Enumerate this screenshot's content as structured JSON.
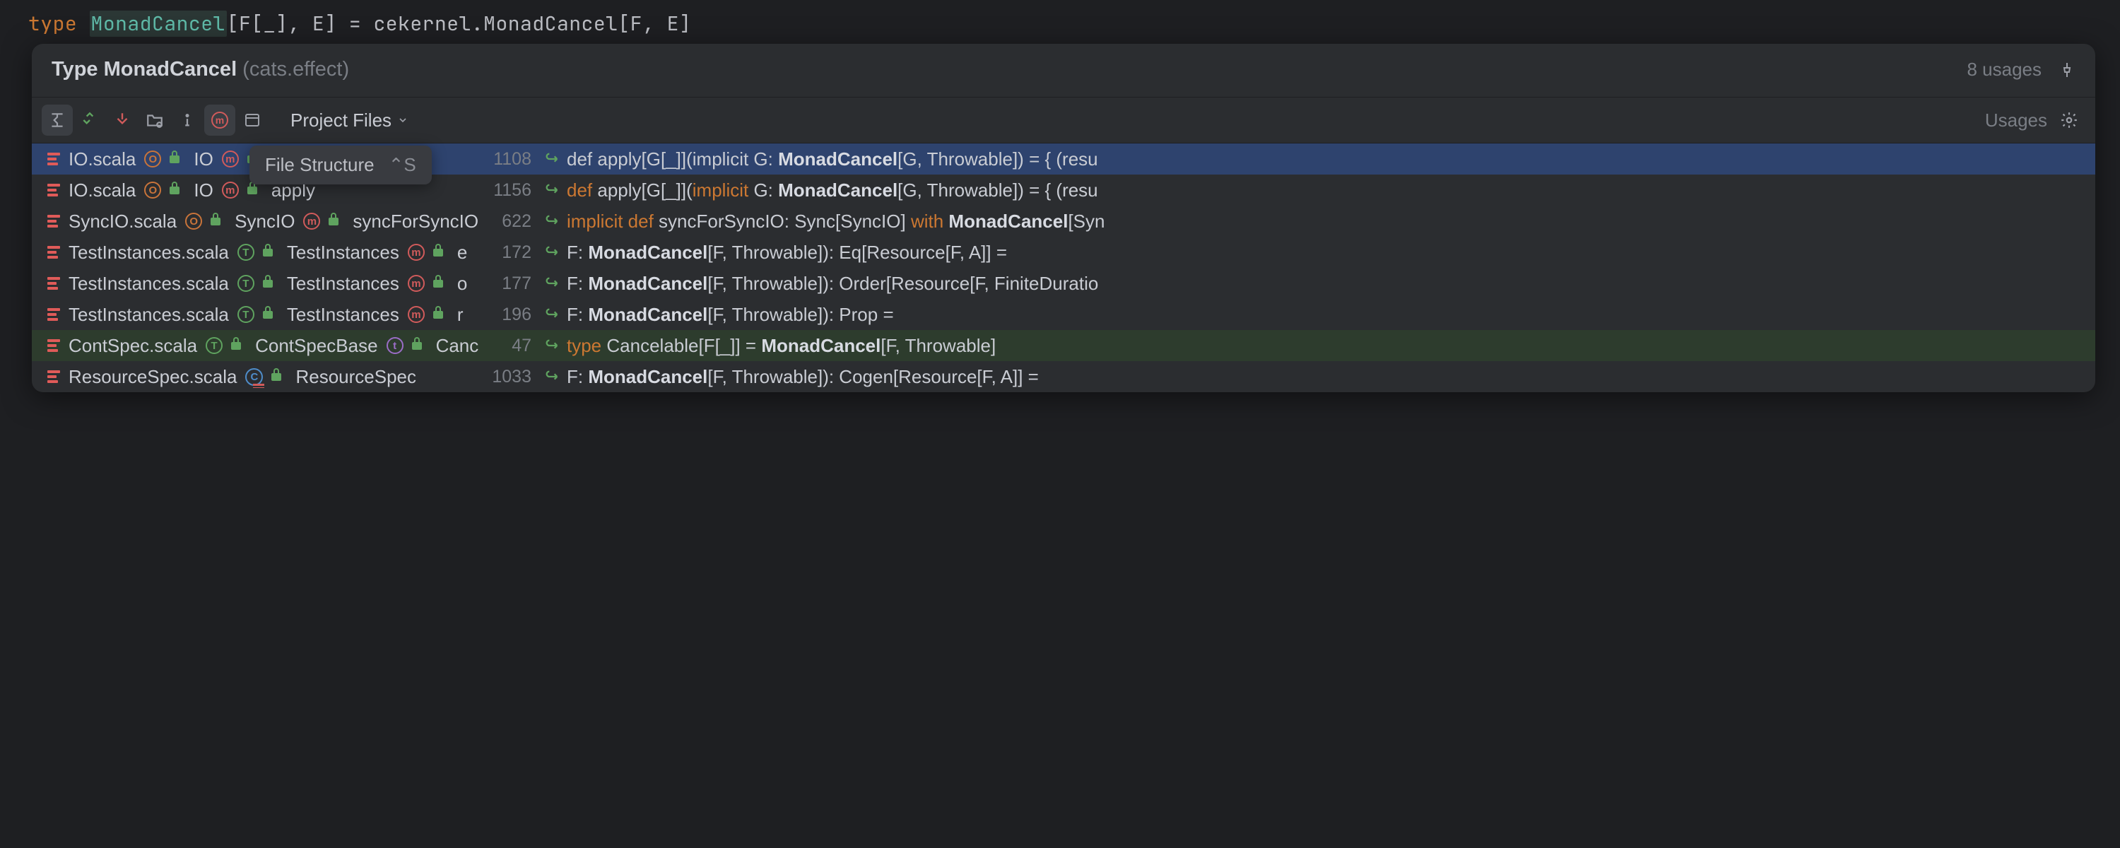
{
  "editor_code": {
    "keyword": "type",
    "name": "MonadCancel",
    "params": "[F[_], E]",
    "eq": " = ",
    "rhs_qual": "cekernel.MonadCancel",
    "rhs_params": "[F, E]"
  },
  "popup": {
    "title_prefix": "Type ",
    "title_name": "MonadCancel",
    "title_pkg": " (cats.effect)",
    "usage_count": "8 usages",
    "scope": "Project Files",
    "usages_label": "Usages"
  },
  "tooltip": {
    "label": "File Structure",
    "shortcut": "⌃S"
  },
  "rows": [
    {
      "file": "IO.scala",
      "class_kind": "O",
      "class_name": "IO",
      "member_kind": "m",
      "member_name": "apply",
      "truncated": true,
      "line": "1108",
      "code_pre": "def apply[G[_]](implicit G: ",
      "code_match": "MonadCancel",
      "code_post": "[G, Throwable]) = { (resu",
      "selected": true
    },
    {
      "file": "IO.scala",
      "class_kind": "O",
      "class_name": "IO",
      "member_kind": "m",
      "member_name": "apply",
      "line": "1156",
      "code_html": "<span class='hl-kw'>def</span> apply[G[_]](<span class='hl-kw'>implicit</span> G: <span class='bold'>MonadCancel</span>[G, Throwable]) = { (resu"
    },
    {
      "file": "SyncIO.scala",
      "class_kind": "O",
      "class_name": "SyncIO",
      "member_kind": "m",
      "member_name": "syncForSyncIO",
      "line": "622",
      "code_html": "<span class='hl-kw'>implicit def</span> syncForSyncIO: Sync[SyncIO] <span class='hl-kw'>with</span> <span class='bold'>MonadCancel</span>[Syn"
    },
    {
      "file": "TestInstances.scala",
      "class_kind": "T",
      "class_name": "TestInstances",
      "member_kind": "m",
      "member_name": "e",
      "truncated": true,
      "line": "172",
      "code_html": "F: <span class='bold'>MonadCancel</span>[F, Throwable]): Eq[Resource[F, A]] ="
    },
    {
      "file": "TestInstances.scala",
      "class_kind": "T",
      "class_name": "TestInstances",
      "member_kind": "m",
      "member_name": "o",
      "truncated": true,
      "line": "177",
      "code_html": "F: <span class='bold'>MonadCancel</span>[F, Throwable]): Order[Resource[F, FiniteDuratio"
    },
    {
      "file": "TestInstances.scala",
      "class_kind": "T",
      "class_name": "TestInstances",
      "member_kind": "m",
      "member_name": "r",
      "truncated": true,
      "line": "196",
      "code_html": "F: <span class='bold'>MonadCancel</span>[F, Throwable]): Prop ="
    },
    {
      "file": "ContSpec.scala",
      "class_kind": "T",
      "class_name": "ContSpecBase",
      "member_kind": "t",
      "member_name": "Canc",
      "truncated": true,
      "line": "47",
      "green": true,
      "code_html": "<span class='hl-kw'>type</span> Cancelable[F[_]] = <span class='bold'>MonadCancel</span>[F, Throwable]"
    },
    {
      "file": "ResourceSpec.scala",
      "class_kind": "C",
      "class_name": "ResourceSpec",
      "member_kind": "",
      "member_name": "",
      "line": "1033",
      "code_html": "F: <span class='bold'>MonadCancel</span>[F, Throwable]): Cogen[Resource[F, A]] ="
    }
  ]
}
